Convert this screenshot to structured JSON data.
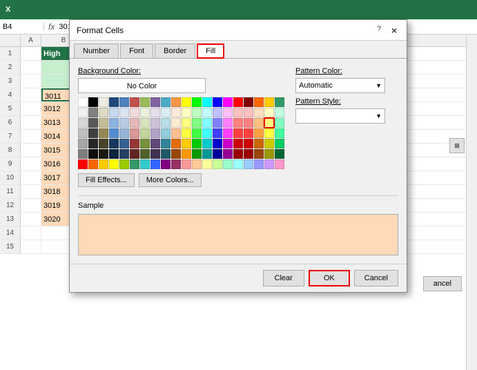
{
  "spreadsheet": {
    "cell_ref": "B4",
    "formula_value": "3011",
    "formula_icon": "fx",
    "header_label": "High",
    "columns": [
      "",
      "A",
      "B"
    ],
    "rows": [
      {
        "num": "1",
        "a": "",
        "b": ""
      },
      {
        "num": "2",
        "a": "",
        "b": ""
      },
      {
        "num": "3",
        "a": "",
        "b": ""
      },
      {
        "num": "4",
        "a": "",
        "b": "3011"
      },
      {
        "num": "5",
        "a": "",
        "b": "3012"
      },
      {
        "num": "6",
        "a": "",
        "b": "3013"
      },
      {
        "num": "7",
        "a": "",
        "b": "3014"
      },
      {
        "num": "8",
        "a": "",
        "b": "3015"
      },
      {
        "num": "9",
        "a": "",
        "b": "3016"
      },
      {
        "num": "10",
        "a": "",
        "b": "3017"
      },
      {
        "num": "11",
        "a": "",
        "b": "3018"
      },
      {
        "num": "12",
        "a": "",
        "b": "3019"
      },
      {
        "num": "13",
        "a": "",
        "b": "3020"
      },
      {
        "num": "14",
        "a": "",
        "b": ""
      },
      {
        "num": "15",
        "a": "",
        "b": ""
      }
    ]
  },
  "dialog": {
    "title": "Format Cells",
    "help_label": "?",
    "close_label": "×",
    "tabs": [
      {
        "id": "number",
        "label": "Number"
      },
      {
        "id": "font",
        "label": "Font"
      },
      {
        "id": "border",
        "label": "Border"
      },
      {
        "id": "fill",
        "label": "Fill",
        "active": true
      }
    ],
    "background_color_label": "Background Color:",
    "no_color_button": "No Color",
    "pattern_color_label": "Pattern Color:",
    "pattern_color_value": "Automatic",
    "pattern_style_label": "Pattern Style:",
    "pattern_style_value": "",
    "fill_effects_button": "Fill Effects...",
    "more_colors_button": "More Colors...",
    "sample_label": "Sample",
    "sample_color": "#FFDAB9",
    "clear_button": "Clear",
    "ok_button": "OK",
    "cancel_button": "Cancel",
    "bg_cancel_button": "ancel"
  },
  "color_grid": {
    "rows": [
      [
        "#FFFFFF",
        "#000000",
        "#EEECE1",
        "#1F497D",
        "#4F81BD",
        "#C0504D",
        "#9BBB59",
        "#8064A2",
        "#4BACC6",
        "#F79646",
        "#FFFF00",
        "#00FF00",
        "#00FFFF",
        "#0000FF",
        "#FF00FF",
        "#FF0000",
        "#800000",
        "#FF6600",
        "#FFCC00",
        "#339966"
      ],
      [
        "#F2F2F2",
        "#808080",
        "#DDD9C3",
        "#C6D9F0",
        "#DBE5F1",
        "#F2DCDB",
        "#EBF1DD",
        "#E5E0EC",
        "#DBEEF3",
        "#FDEADA",
        "#FFFFC0",
        "#C0FFC0",
        "#C0FFFF",
        "#C0C0FF",
        "#FFC0FF",
        "#FFC0C0",
        "#FFC0C0",
        "#FFE0C0",
        "#FFFFC0",
        "#C0FFE0"
      ],
      [
        "#D8D8D8",
        "#595959",
        "#C4BD97",
        "#8DB3E2",
        "#B8CCE4",
        "#E6B8B7",
        "#D7E4BC",
        "#CCC1D9",
        "#B7DEE8",
        "#FCECD2",
        "#FFFF80",
        "#80FF80",
        "#80FFFF",
        "#8080FF",
        "#FF80FF",
        "#FF8080",
        "#FF8080",
        "#FFC080",
        "#FFFF80",
        "#80FFC0"
      ],
      [
        "#BFBFBF",
        "#3F3F3F",
        "#938953",
        "#548DD4",
        "#95B3D7",
        "#D99694",
        "#C3D69B",
        "#B2A2C7",
        "#92CDDC",
        "#FAC090",
        "#FFFF40",
        "#40FF40",
        "#40FFFF",
        "#4040FF",
        "#FF40FF",
        "#FF4040",
        "#FF4040",
        "#FFA040",
        "#FFFF40",
        "#40FFA0"
      ],
      [
        "#A6A6A6",
        "#262626",
        "#494429",
        "#17375E",
        "#366092",
        "#963634",
        "#76923C",
        "#5F497A",
        "#31849B",
        "#E36C09",
        "#FFCC00",
        "#00CC00",
        "#00CCCC",
        "#0000CC",
        "#CC00CC",
        "#CC0000",
        "#CC0000",
        "#CC6600",
        "#CCCC00",
        "#00CC66"
      ],
      [
        "#7F7F7F",
        "#0D0D0D",
        "#1D1B10",
        "#0F243E",
        "#244062",
        "#632523",
        "#4F6228",
        "#3F3151",
        "#205867",
        "#974706",
        "#FF9900",
        "#009900",
        "#009999",
        "#000099",
        "#990099",
        "#990000",
        "#990000",
        "#994400",
        "#999900",
        "#006633"
      ],
      [
        "#FF0000",
        "#FF6600",
        "#FFCC00",
        "#FFFF00",
        "#99CC00",
        "#339966",
        "#33CCCC",
        "#3366FF",
        "#800080",
        "#993366",
        "#FF9999",
        "#FFCC99",
        "#FFFF99",
        "#CCFF99",
        "#99FFCC",
        "#99FFFF",
        "#99CCFF",
        "#9999FF",
        "#CC99FF",
        "#FF99CC"
      ]
    ],
    "selected_row": 2,
    "selected_col": 18
  }
}
